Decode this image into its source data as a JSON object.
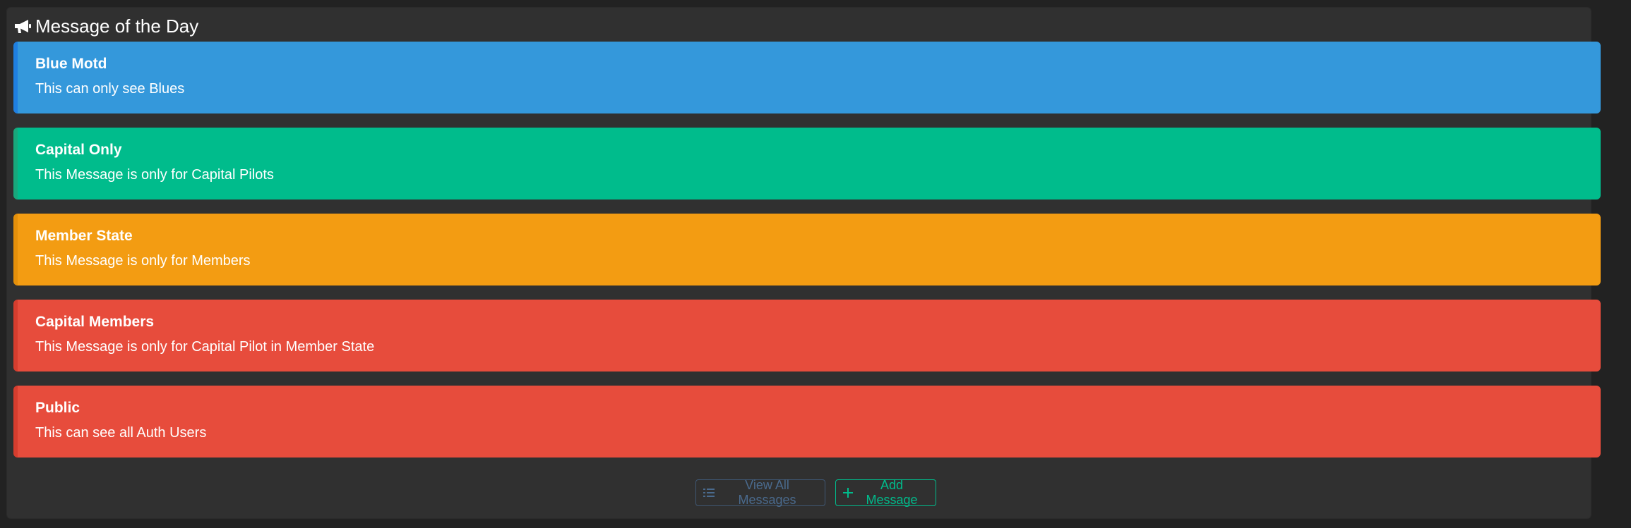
{
  "panel": {
    "title": "Message of the Day",
    "title_icon": "bullhorn-icon"
  },
  "alerts": [
    {
      "title": "Blue Motd",
      "body": "This can only see Blues",
      "color": "#3498db",
      "border": "#1f7fe0"
    },
    {
      "title": "Capital Only",
      "body": "This Message is only for Capital Pilots",
      "color": "#00bc8c",
      "border": "#18a87c"
    },
    {
      "title": "Member State",
      "body": "This Message is only for Members",
      "color": "#f39c12",
      "border": "#e48f0a"
    },
    {
      "title": "Capital Members",
      "body": "This Message is only for Capital Pilot in Member State",
      "color": "#e74c3c",
      "border": "#d63d2e"
    },
    {
      "title": "Public",
      "body": "This can see all Auth Users",
      "color": "#e74c3c",
      "border": "#d63d2e"
    }
  ],
  "footer": {
    "view_all_label": "View All Messages",
    "view_all_icon": "list-icon",
    "add_label": "Add Message",
    "add_icon": "plus-icon"
  }
}
